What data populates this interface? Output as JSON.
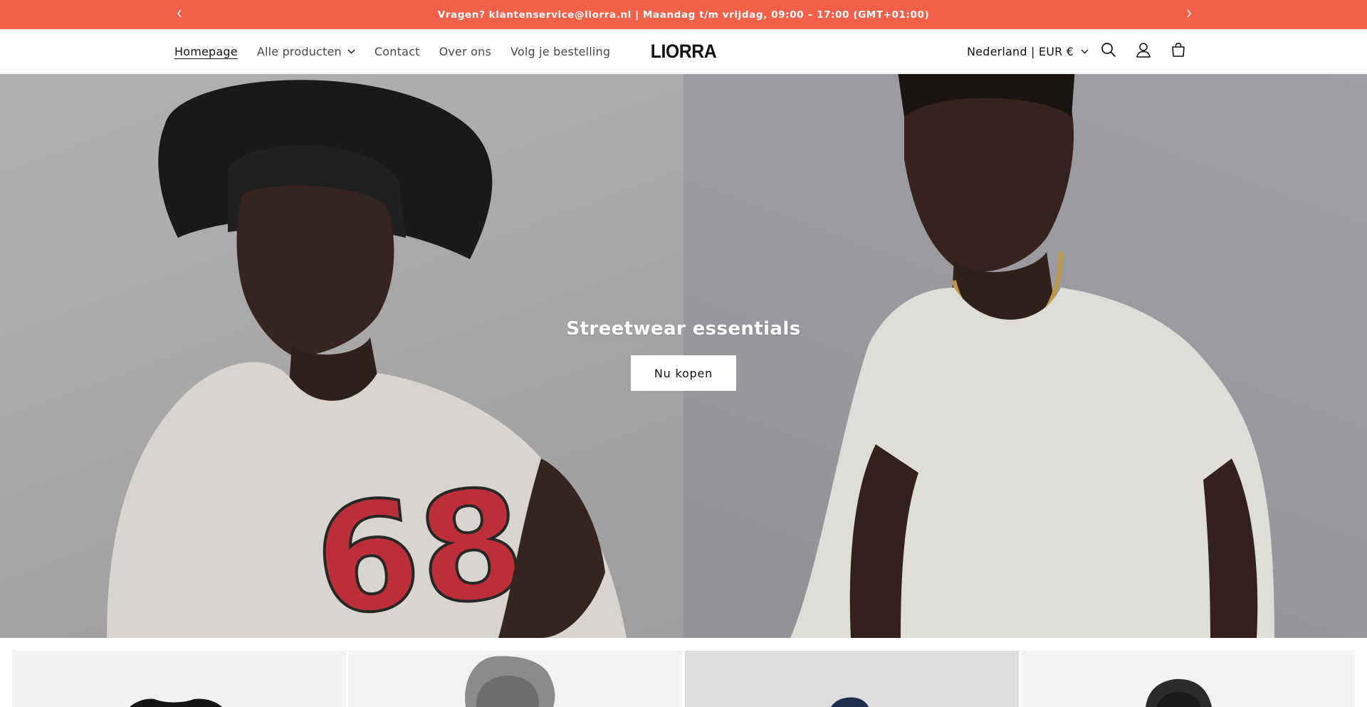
{
  "announcement": {
    "text": "Vragen? klantenservice@liorra.nl | Maandag t/m vrijdag, 09:00 – 17:00 (GMT+01:00)",
    "prev_icon": "chevron-left-icon",
    "next_icon": "chevron-right-icon"
  },
  "header": {
    "nav": [
      {
        "label": "Homepage",
        "active": true
      },
      {
        "label": "Alle producten",
        "has_dropdown": true
      },
      {
        "label": "Contact"
      },
      {
        "label": "Over ons"
      },
      {
        "label": "Volg je bestelling"
      }
    ],
    "logo": "LIORRA",
    "locale": "Nederland | EUR €",
    "icons": [
      "search-icon",
      "account-icon",
      "cart-icon"
    ]
  },
  "hero": {
    "heading": "Streetwear essentials",
    "button_label": "Nu kopen",
    "left_image": "model-bucket-hat-white-tee",
    "right_image": "model-white-tee-gold-chain"
  },
  "products": {
    "cards": [
      {
        "image": "black-tshirt-product-image"
      },
      {
        "image": "grey-hoodie-product-image"
      },
      {
        "image": "navy-cap-product-image"
      },
      {
        "image": "black-hoodie-product-image"
      }
    ]
  },
  "colors": {
    "accent": "#f3604a",
    "text": "#121212",
    "background": "#ffffff"
  }
}
